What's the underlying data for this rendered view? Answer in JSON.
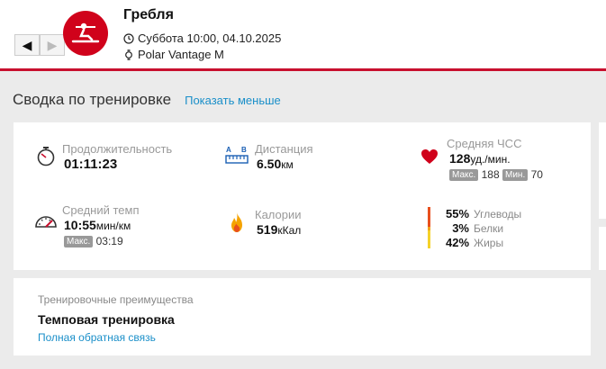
{
  "header": {
    "title": "Гребля",
    "date": "Суббота 10:00, 04.10.2025",
    "device": "Polar Vantage M",
    "prev_label": "◀",
    "next_label": "▶",
    "accent_color": "#c8102e"
  },
  "summary": {
    "title": "Сводка по тренировке",
    "toggle_link": "Показать меньше"
  },
  "stats": {
    "duration": {
      "label": "Продолжительность",
      "value": "01:11:23",
      "icon": "stopwatch-icon"
    },
    "distance": {
      "label": "Дистанция",
      "value": "6.50",
      "unit": "км",
      "icon": "distance-icon"
    },
    "heart_rate": {
      "label": "Средняя ЧСС",
      "value": "128",
      "unit": "уд./мин.",
      "max_badge": "Макс.",
      "max_value": "188",
      "min_badge": "Мин.",
      "min_value": "70",
      "icon": "heart-icon"
    },
    "pace": {
      "label": "Средний темп",
      "value": "10:55",
      "unit": "мин/км",
      "max_badge": "Макс.",
      "max_value": "03:19",
      "icon": "speedometer-icon"
    },
    "calories": {
      "label": "Калории",
      "value": "519",
      "unit": "кКал",
      "icon": "flame-icon"
    }
  },
  "macros": [
    {
      "percent": "55%",
      "name": "Углеводы",
      "color": "#e8501e"
    },
    {
      "percent": "3%",
      "name": "Белки",
      "color": "#f2a31a"
    },
    {
      "percent": "42%",
      "name": "Жиры",
      "color": "#f5d22a"
    }
  ],
  "benefit": {
    "label": "Тренировочные преимущества",
    "value": "Темповая тренировка",
    "link": "Полная обратная связь"
  }
}
